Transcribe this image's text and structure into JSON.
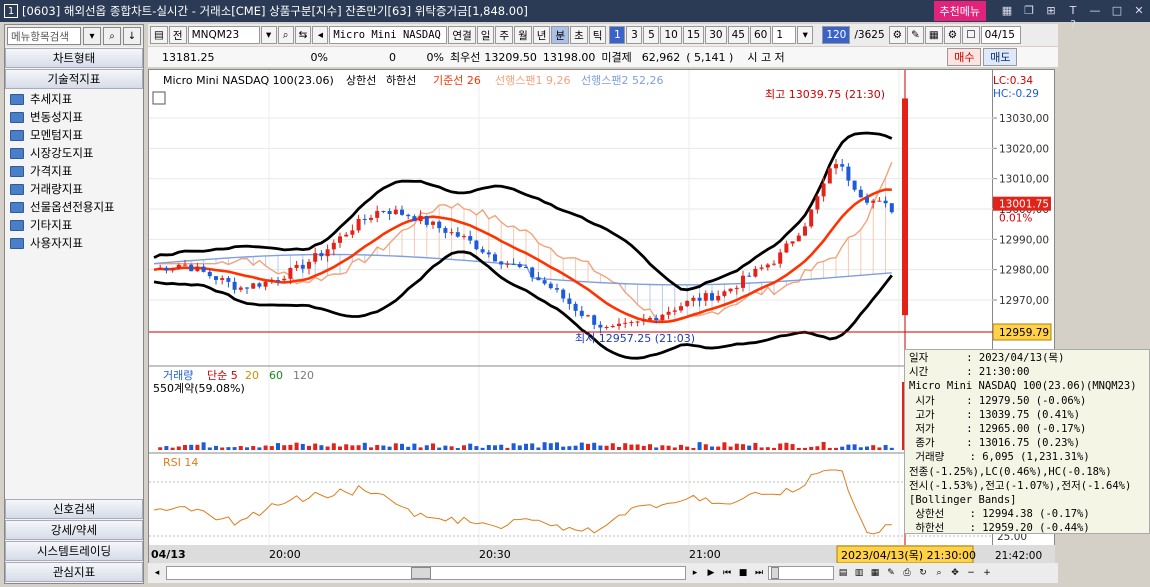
{
  "titlebar": {
    "window_number": "1",
    "title": "[0603] 해외선옵 종합차트-실시간 - 거래소[CME] 상품구분[지수] 잔존만기[63] 위탁증거금[1,848.00]",
    "recommend_menu": "추천메뉴",
    "help": "T ?"
  },
  "left_panel": {
    "search_placeholder": "메뉴항목검색",
    "chart_type": "차트형태",
    "tech_indicators": "기술적지표",
    "items": [
      {
        "label": "추세지표"
      },
      {
        "label": "변동성지표"
      },
      {
        "label": "모멘텀지표"
      },
      {
        "label": "시장강도지표"
      },
      {
        "label": "가격지표"
      },
      {
        "label": "거래량지표"
      },
      {
        "label": "선물옵션전용지표"
      },
      {
        "label": "기타지표"
      },
      {
        "label": "사용자지표"
      }
    ],
    "bottom_buttons": [
      {
        "label": "신호검색"
      },
      {
        "label": "강세/약세"
      },
      {
        "label": "시스템트레이딩"
      },
      {
        "label": "관심지표"
      }
    ]
  },
  "toolbar": {
    "all": "전",
    "symbol": "MNQM23",
    "name": "Micro Mini NASDAQ 10",
    "periods": [
      {
        "label": "연결"
      },
      {
        "label": "일"
      },
      {
        "label": "주"
      },
      {
        "label": "월"
      },
      {
        "label": "년"
      },
      {
        "label": "분"
      },
      {
        "label": "초"
      },
      {
        "label": "틱"
      }
    ],
    "intervals": [
      {
        "label": "1"
      },
      {
        "label": "3"
      },
      {
        "label": "5"
      },
      {
        "label": "10"
      },
      {
        "label": "15"
      },
      {
        "label": "30"
      },
      {
        "label": "45"
      },
      {
        "label": "60"
      }
    ],
    "interval_select": "1",
    "count": "120",
    "count_total": "/3625",
    "date": "04/15"
  },
  "info_bar": {
    "price": "13181.25",
    "pct": "0%",
    "vol": "0",
    "vol_pct": "0%",
    "best_buy_label": "최우선",
    "best_buy": "13209.50",
    "best_sell": "13198.00",
    "open_interest_label": "미결제",
    "open_interest": "62,962",
    "oi_change": "( 5,141 )",
    "right_text": "시          고          저",
    "buy": "매수",
    "sell": "매도"
  },
  "chart": {
    "legend_name": "Micro Mini NASDAQ 100(23.06)",
    "legend_upper": "상한선",
    "legend_lower": "하한선",
    "legend_base": "기준선 26",
    "legend_span1": "선행스팬1 9,26",
    "legend_span2": "선행스팬2 52,26",
    "high_label": "최고 13039.75 (21:30)",
    "low_label": "최저 12957.25 (21:03)",
    "lc": "LC:0.34",
    "hc": "HC:-0.29",
    "price_ticks": [
      "13030,00",
      "13020,00",
      "13010,00",
      "13000,00",
      "12990,00",
      "12980,00",
      "12970,00"
    ],
    "price_tick_values": [
      13030,
      13020,
      13010,
      13000,
      12990,
      12980,
      12970
    ],
    "current_price": "13001.75",
    "current_pct": "0.01%",
    "crosshair_price": "12959.79",
    "volume_label": "거래량",
    "volume_ma": [
      "단순 5",
      "20",
      "60",
      "120"
    ],
    "volume_value": "550계약(59.08%)",
    "rsi_label": "RSI 14",
    "rsi_tick": "25.00",
    "time_ticks": [
      "04/13",
      "20:00",
      "20:30",
      "21:00",
      "21:42:00"
    ],
    "crosshair_time": "2023/04/13(목) 21:30:00",
    "colors": {
      "up": "#e2231a",
      "down": "#1e5bd8",
      "band": "#000000",
      "base": "#ff3300",
      "span1": "#f4a27a",
      "span2": "#7f9fe0",
      "rsi": "#e07b1d"
    }
  },
  "tooltip": {
    "lines": [
      "일자      : 2023/04/13(목)",
      "시간      : 21:30:00",
      "Micro Mini NASDAQ 100(23.06)(MNQM23)",
      " 시가     : 12979.50 (-0.06%)",
      " 고가     : 13039.75 (0.41%)",
      " 저가     : 12965.00 (-0.17%)",
      " 종가     : 13016.75 (0.23%)",
      " 거래량    : 6,095 (1,231.31%)",
      "전종(-1.25%),LC(0.46%),HC(-0.18%)",
      "전시(-1.53%),전고(-1.07%),전저(-1.64%)",
      "[Bollinger Bands]",
      " 상한선    : 12994.38 (-0.17%)",
      " 하한선    : 12959.20 (-0.44%)"
    ]
  }
}
